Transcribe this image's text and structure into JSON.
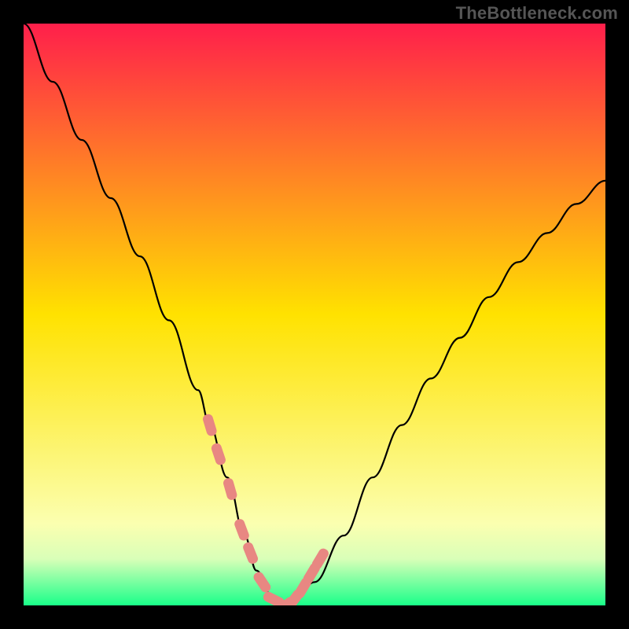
{
  "watermark": "TheBottleneck.com",
  "colors": {
    "background": "#000000",
    "gradient_top": "#ff1f4b",
    "gradient_mid": "#ffe200",
    "gradient_low": "#fbffb0",
    "gradient_bottom": "#19ff89",
    "curve": "#000000",
    "marker_fill": "#e88782",
    "marker_stroke": "#d76b67"
  },
  "chart_data": {
    "type": "line",
    "title": "",
    "xlabel": "",
    "ylabel": "",
    "xlim": [
      0,
      100
    ],
    "ylim": [
      0,
      100
    ],
    "grid": false,
    "legend": false,
    "series": [
      {
        "name": "bottleneck-curve",
        "x": [
          0,
          5,
          10,
          15,
          20,
          25,
          30,
          32,
          35,
          38,
          40,
          43,
          46,
          50,
          55,
          60,
          65,
          70,
          75,
          80,
          85,
          90,
          95,
          100
        ],
        "values": [
          100,
          90,
          80,
          70,
          60,
          49,
          37,
          31,
          22,
          12,
          6,
          1,
          0,
          4,
          12,
          22,
          31,
          39,
          46,
          53,
          59,
          64,
          69,
          73
        ]
      }
    ],
    "markers": {
      "name": "highlighted-range",
      "x": [
        32,
        33.5,
        35.5,
        37.5,
        39,
        41,
        43,
        45,
        46.5,
        48,
        49.5,
        51
      ],
      "values": [
        31,
        26,
        20,
        13,
        9,
        4,
        1,
        0,
        1,
        3,
        5.5,
        8
      ]
    },
    "background_gradient": {
      "stops": [
        {
          "offset": 0.0,
          "color": "#ff1f4b"
        },
        {
          "offset": 0.5,
          "color": "#ffe200"
        },
        {
          "offset": 0.86,
          "color": "#fbffb0"
        },
        {
          "offset": 0.92,
          "color": "#d9ffb8"
        },
        {
          "offset": 1.0,
          "color": "#19ff89"
        }
      ]
    }
  }
}
